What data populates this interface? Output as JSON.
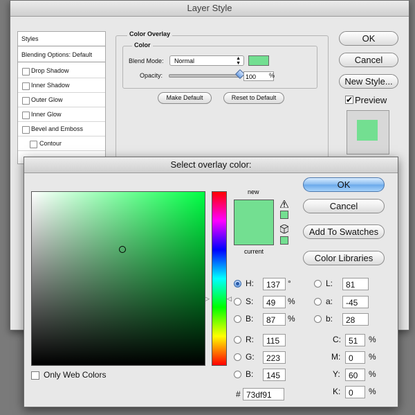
{
  "layer_style": {
    "title": "Layer Style",
    "styles_list": {
      "header": "Styles",
      "blending": "Blending Options: Default",
      "items": [
        "Drop Shadow",
        "Inner Shadow",
        "Outer Glow",
        "Inner Glow",
        "Bevel and Emboss",
        "Contour"
      ]
    },
    "color_overlay": {
      "section_title": "Color Overlay",
      "group_title": "Color",
      "blend_mode_label": "Blend Mode:",
      "blend_mode_value": "Normal",
      "opacity_label": "Opacity:",
      "opacity_value": "100",
      "opacity_unit": "%",
      "opacity_level": 1.0,
      "make_default": "Make Default",
      "reset_default": "Reset to Default"
    },
    "buttons": {
      "ok": "OK",
      "cancel": "Cancel",
      "new_style": "New Style..."
    },
    "preview_label": "Preview",
    "preview_checked": true
  },
  "color_picker": {
    "title": "Select overlay color:",
    "new_label": "new",
    "current_label": "current",
    "color_hex_css": "#73df91",
    "buttons": {
      "ok": "OK",
      "cancel": "Cancel",
      "add_swatches": "Add To Swatches",
      "libraries": "Color Libraries"
    },
    "hsb": {
      "h": {
        "label": "H:",
        "value": "137",
        "unit": "°",
        "selected": true
      },
      "s": {
        "label": "S:",
        "value": "49",
        "unit": "%"
      },
      "b": {
        "label": "B:",
        "value": "87",
        "unit": "%"
      }
    },
    "rgb": {
      "r": {
        "label": "R:",
        "value": "115"
      },
      "g": {
        "label": "G:",
        "value": "223"
      },
      "b": {
        "label": "B:",
        "value": "145"
      }
    },
    "lab": {
      "l": {
        "label": "L:",
        "value": "81"
      },
      "a": {
        "label": "a:",
        "value": "-45"
      },
      "b": {
        "label": "b:",
        "value": "28"
      }
    },
    "cmyk": {
      "c": {
        "label": "C:",
        "value": "51",
        "unit": "%"
      },
      "m": {
        "label": "M:",
        "value": "0",
        "unit": "%"
      },
      "y": {
        "label": "Y:",
        "value": "60",
        "unit": "%"
      },
      "k": {
        "label": "K:",
        "value": "0",
        "unit": "%"
      }
    },
    "hex": {
      "label": "#",
      "value": "73df91"
    },
    "only_web_colors": "Only Web Colors"
  },
  "colors": {
    "overlay": "#73df91",
    "field_hue": "#00ff44",
    "accent": "#6aa8ea"
  },
  "icons": [
    "warning-icon",
    "cube-icon",
    "hue-slider-arrow-icon"
  ]
}
